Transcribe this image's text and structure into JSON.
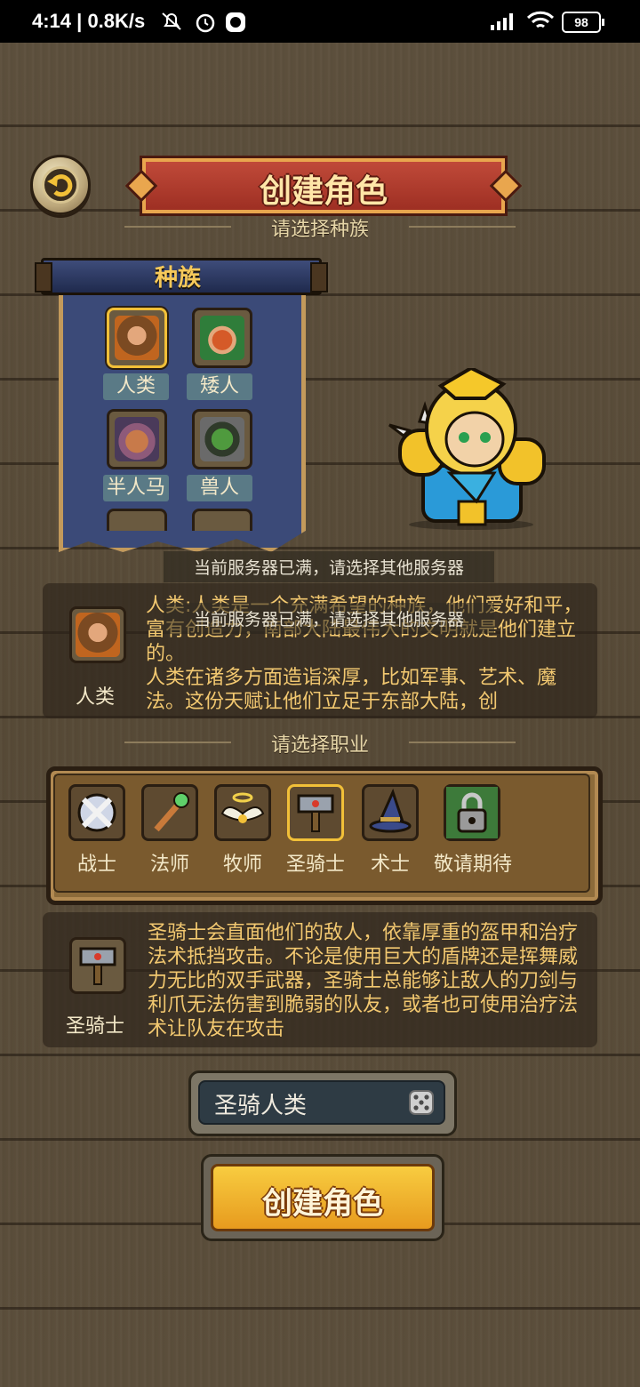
{
  "status_bar": {
    "time": "4:14",
    "speed": "0.8K/s",
    "battery": "98"
  },
  "header": {
    "title": "创建角色"
  },
  "race_section": {
    "prompt": "请选择种族",
    "banner_title": "种族",
    "races": [
      {
        "label": "人类",
        "selected": true
      },
      {
        "label": "矮人",
        "selected": false
      },
      {
        "label": "半人马",
        "selected": false
      },
      {
        "label": "兽人",
        "selected": false
      }
    ]
  },
  "toast": {
    "message": "当前服务器已满，请选择其他服务器"
  },
  "race_info": {
    "name": "人类",
    "text": "人类:人类是一个充满希望的种族，他们爱好和平，富有创造力，南部大陆最伟大的文明就是他们建立的。\n人类在诸多方面造诣深厚，比如军事、艺术、魔法。这份天赋让他们立足于东部大陆，创"
  },
  "class_section": {
    "prompt": "请选择职业",
    "classes": [
      {
        "label": "战士",
        "icon": "crossed-swords-shield-icon",
        "selected": false
      },
      {
        "label": "法师",
        "icon": "magic-staff-icon",
        "selected": false
      },
      {
        "label": "牧师",
        "icon": "angel-wings-icon",
        "selected": false
      },
      {
        "label": "圣骑士",
        "icon": "war-hammer-icon",
        "selected": true
      },
      {
        "label": "术士",
        "icon": "wizard-hat-icon",
        "selected": false
      },
      {
        "label": "敬请期待",
        "icon": "locked-padlock-icon",
        "selected": false
      }
    ]
  },
  "class_info": {
    "name": "圣骑士",
    "text": "圣骑士会直面他们的敌人，依靠厚重的盔甲和治疗法术抵挡攻击。不论是使用巨大的盾牌还是挥舞威力无比的双手武器，圣骑士总能够让敌人的刀剑与利爪无法伤害到脆弱的队友，或者也可使用治疗法术让队友在攻击"
  },
  "name_field": {
    "value": "圣骑人类"
  },
  "create_button": {
    "label": "创建角色"
  },
  "colors": {
    "accent_gold": "#f2c038",
    "title_red": "#b03c2e",
    "text_gold": "#f2c870"
  }
}
